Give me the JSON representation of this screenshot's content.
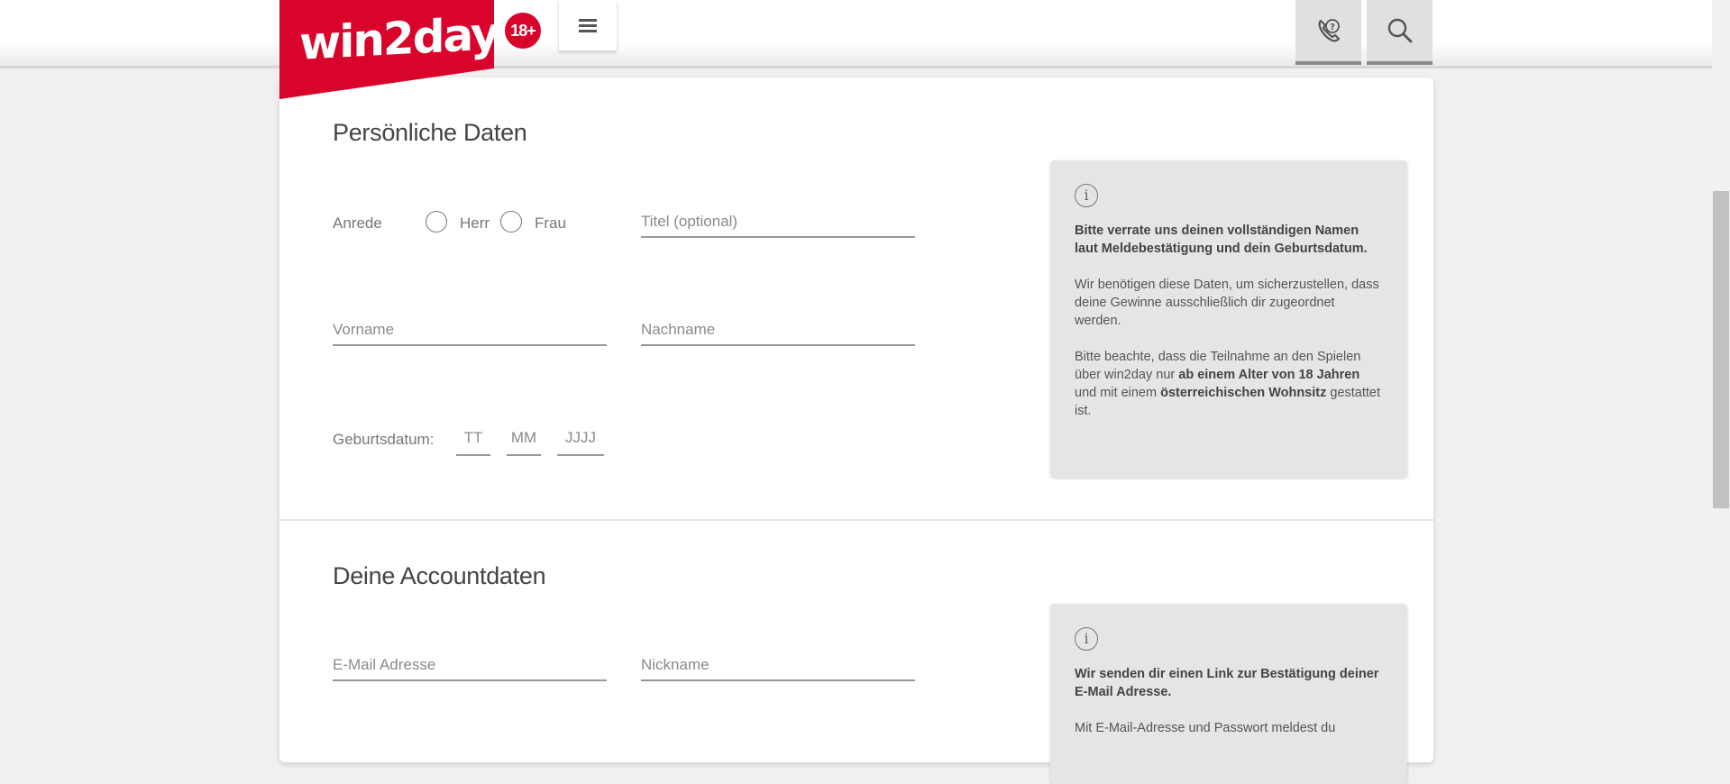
{
  "header": {
    "logo_text": "win2day",
    "age_badge": "18+"
  },
  "personal": {
    "title": "Persönliche Daten",
    "salutation_label": "Anrede",
    "option_herr": "Herr",
    "option_frau": "Frau",
    "titel_placeholder": "Titel (optional)",
    "vorname_placeholder": "Vorname",
    "nachname_placeholder": "Nachname",
    "birthdate_label": "Geburtsdatum:",
    "day_placeholder": "TT",
    "month_placeholder": "MM",
    "year_placeholder": "JJJJ",
    "info": {
      "p1_bold": "Bitte verrate uns deinen vollständigen Namen laut Meldebestätigung und dein Geburtsdatum.",
      "p2": "Wir benötigen diese Daten, um sicherzustellen, dass deine Gewinne ausschließlich dir zugeordnet werden.",
      "p3_a": "Bitte beachte, dass die Teilnahme an den Spielen über win2day nur ",
      "p3_b": "ab einem Alter von 18 Jahren",
      "p3_c": " und mit einem ",
      "p3_d": "österreichischen Wohnsitz",
      "p3_e": " gestattet ist."
    }
  },
  "account": {
    "title": "Deine Accountdaten",
    "email_placeholder": "E-Mail Adresse",
    "nickname_placeholder": "Nickname",
    "info": {
      "p1_bold": "Wir senden dir einen Link zur Bestätigung deiner E-Mail Adresse.",
      "p2": "Mit E-Mail-Adresse und Passwort meldest du"
    }
  }
}
